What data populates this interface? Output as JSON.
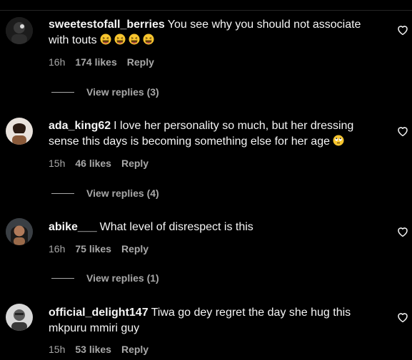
{
  "comments": [
    {
      "username": "sweetestofall_berries",
      "text": "You see why you should not associate with touts",
      "emojis": [
        "grinning-squinting-face",
        "grinning-squinting-face",
        "grinning-squinting-face",
        "grinning-squinting-face"
      ],
      "time": "16h",
      "likes": "174 likes",
      "reply": "Reply",
      "view_replies": "View replies (3)"
    },
    {
      "username": "ada_king62",
      "text": "I love her personality so much, but her dressing sense this days is becoming something else for her age",
      "emojis": [
        "face-with-rolling-eyes"
      ],
      "time": "15h",
      "likes": "46 likes",
      "reply": "Reply",
      "view_replies": "View replies (4)"
    },
    {
      "username": "abike___",
      "text": "What level of disrespect is this",
      "emojis": [],
      "time": "16h",
      "likes": "75 likes",
      "reply": "Reply",
      "view_replies": "View replies (1)"
    },
    {
      "username": "official_delight147",
      "text": "Tiwa go dey regret the day she hug this mkpuru mmiri guy",
      "emojis": [],
      "time": "15h",
      "likes": "53 likes",
      "reply": "Reply"
    }
  ],
  "colors": {
    "background": "#000000",
    "primary_text": "#f5f5f5",
    "secondary_text": "#a8a8a8",
    "divider": "#262626"
  },
  "icons": {
    "like": "heart-outline-icon"
  }
}
